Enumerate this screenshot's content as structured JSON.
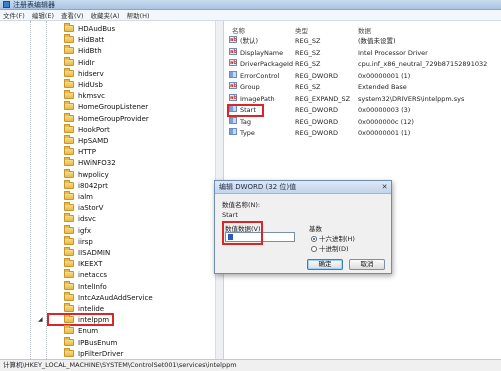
{
  "window": {
    "title": "注册表编辑器"
  },
  "menu": [
    "文件(F)",
    "编辑(E)",
    "查看(V)",
    "收藏夹(A)",
    "帮助(H)"
  ],
  "tree": {
    "items": [
      {
        "label": "HDAudBus"
      },
      {
        "label": "HidBatt"
      },
      {
        "label": "HidBth"
      },
      {
        "label": "HidIr"
      },
      {
        "label": "hidserv"
      },
      {
        "label": "HidUsb"
      },
      {
        "label": "hkmsvc"
      },
      {
        "label": "HomeGroupListener"
      },
      {
        "label": "HomeGroupProvider"
      },
      {
        "label": "HookPort"
      },
      {
        "label": "HpSAMD"
      },
      {
        "label": "HTTP"
      },
      {
        "label": "HWiNFO32"
      },
      {
        "label": "hwpolicy"
      },
      {
        "label": "i8042prt"
      },
      {
        "label": "ialm"
      },
      {
        "label": "iaStorV"
      },
      {
        "label": "idsvc"
      },
      {
        "label": "igfx"
      },
      {
        "label": "iirsp"
      },
      {
        "label": "IISADMIN"
      },
      {
        "label": "IKEEXT"
      },
      {
        "label": "inetaccs"
      },
      {
        "label": "IntelInfo"
      },
      {
        "label": "IntcAzAudAddService"
      },
      {
        "label": "intelide"
      },
      {
        "label": "intelppm",
        "expanded": true,
        "highlight": true
      },
      {
        "label": "Enum",
        "child": true
      },
      {
        "label": "IPBusEnum"
      },
      {
        "label": "IpFilterDriver"
      },
      {
        "label": "iphlpsvc"
      },
      {
        "label": "IPMIDRV"
      }
    ]
  },
  "list": {
    "headers": {
      "name": "名称",
      "type": "类型",
      "data": "数据"
    },
    "rows": [
      {
        "icon": "string-value-icon",
        "name": "(默认)",
        "type": "REG_SZ",
        "data": "(数值未设置)"
      },
      {
        "icon": "string-value-icon",
        "name": "DisplayName",
        "type": "REG_SZ",
        "data": "Intel Processor Driver"
      },
      {
        "icon": "string-value-icon",
        "name": "DriverPackageId",
        "type": "REG_SZ",
        "data": "cpu.inf_x86_neutral_729b87152891032"
      },
      {
        "icon": "dword-value-icon",
        "name": "ErrorControl",
        "type": "REG_DWORD",
        "data": "0x00000001 (1)"
      },
      {
        "icon": "string-value-icon",
        "name": "Group",
        "type": "REG_SZ",
        "data": "Extended Base"
      },
      {
        "icon": "string-value-icon",
        "name": "ImagePath",
        "type": "REG_EXPAND_SZ",
        "data": "system32\\DRIVERS\\intelppm.sys"
      },
      {
        "icon": "dword-value-icon",
        "name": "Start",
        "type": "REG_DWORD",
        "data": "0x00000003 (3)",
        "highlight": true
      },
      {
        "icon": "dword-value-icon",
        "name": "Tag",
        "type": "REG_DWORD",
        "data": "0x0000000c (12)"
      },
      {
        "icon": "dword-value-icon",
        "name": "Type",
        "type": "REG_DWORD",
        "data": "0x00000001 (1)"
      }
    ]
  },
  "status": {
    "path": "计算机\\HKEY_LOCAL_MACHINE\\SYSTEM\\ControlSet001\\services\\intelppm"
  },
  "dialog": {
    "title": "编辑 DWORD (32 位)值",
    "name_label": "数值名称(N):",
    "name_value": "Start",
    "data_label": "数值数据(V):",
    "data_value": "",
    "base_label": "基数",
    "radio_hex": "十六进制(H)",
    "radio_dec": "十进制(D)",
    "ok": "确定",
    "cancel": "取消"
  },
  "colors": {
    "highlight_border": "#d8262b",
    "folder": "#e9b949"
  }
}
